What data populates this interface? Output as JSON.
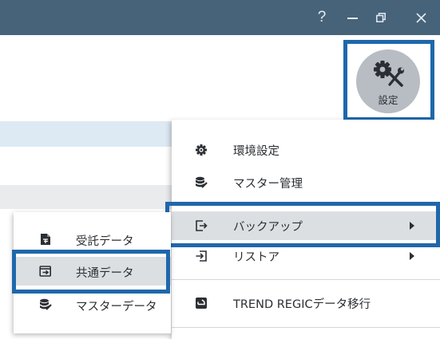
{
  "titlebar": {
    "help": "?",
    "bg_color": "#46637a"
  },
  "settings": {
    "label": "設定",
    "icon": "gear-wrench-icon"
  },
  "menu": {
    "items": [
      {
        "label": "環境設定",
        "icon": "gear-icon"
      },
      {
        "label": "マスター管理",
        "icon": "database-icon"
      },
      {
        "label": "バックアップ",
        "icon": "export-icon",
        "has_submenu": true
      },
      {
        "label": "リストア",
        "icon": "import-icon",
        "has_submenu": true
      },
      {
        "label": "TREND REGICデータ移行",
        "icon": "transfer-icon"
      }
    ]
  },
  "submenu": {
    "items": [
      {
        "label": "受託データ",
        "icon": "document-icon"
      },
      {
        "label": "共通データ",
        "icon": "export-box-icon"
      },
      {
        "label": "マスターデータ",
        "icon": "database-icon"
      }
    ]
  },
  "colors": {
    "highlight": "#1f67ab",
    "hover": "#dcdfe2"
  }
}
